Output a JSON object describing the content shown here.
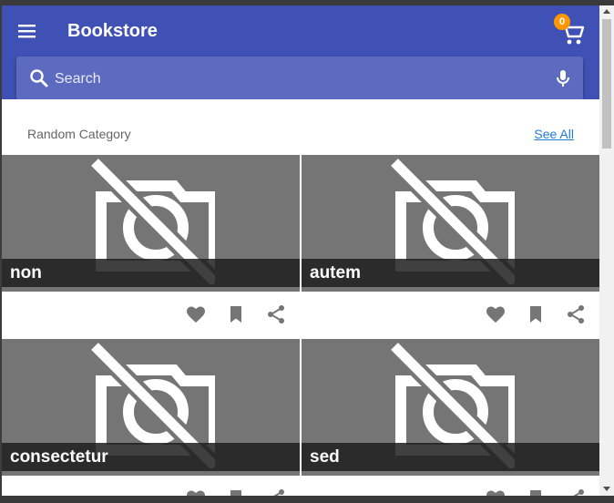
{
  "appbar": {
    "title": "Bookstore",
    "cart_count": "0",
    "color": "#3f51b5",
    "badge_color": "#ff9800"
  },
  "search": {
    "placeholder": "Search"
  },
  "section": {
    "title": "Random Category",
    "see_all": "See All"
  },
  "cards": [
    {
      "title": "non"
    },
    {
      "title": "autem"
    },
    {
      "title": "consectetur"
    },
    {
      "title": "sed"
    }
  ],
  "icons": {
    "menu": "menu-icon",
    "cart": "cart-icon",
    "search": "search-icon",
    "mic": "mic-icon",
    "placeholder": "image-unavailable-icon",
    "favorite": "heart-icon",
    "bookmark": "bookmark-icon",
    "share": "share-icon"
  }
}
